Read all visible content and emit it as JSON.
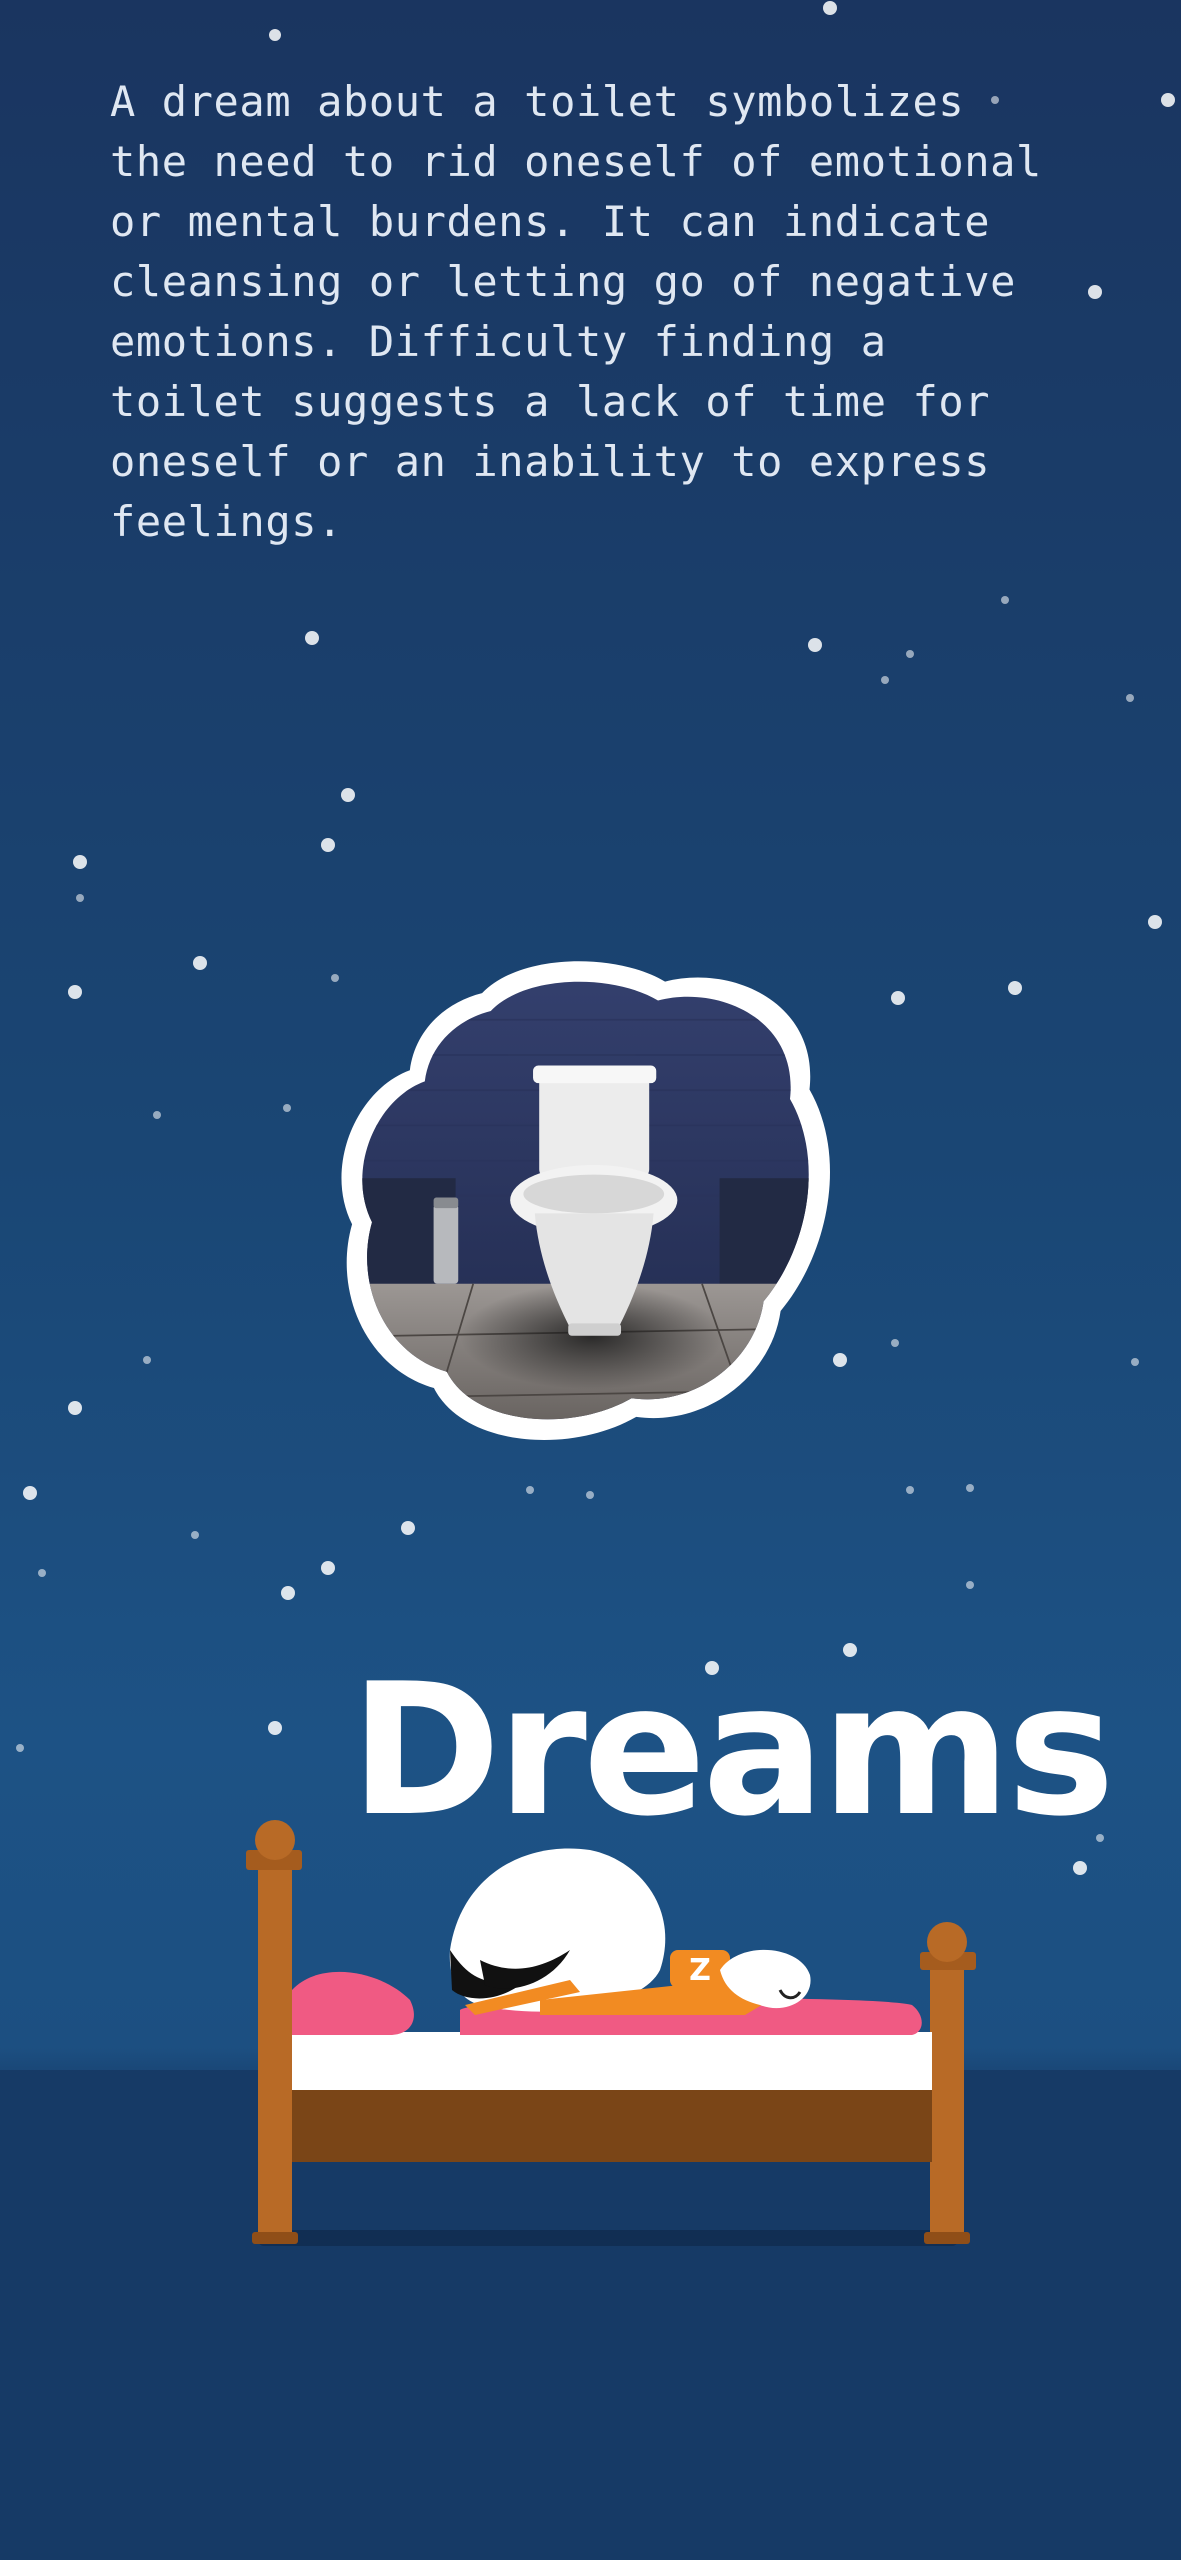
{
  "dream_text": "A dream about a toilet symbolizes\nthe need to rid oneself of emotional\nor mental burdens. It can indicate\ncleansing or letting go of negative\nemotions. Difficulty finding a\ntoilet suggests a lack of time for\noneself or an inability to express\nfeelings.",
  "brand": {
    "title": "Dreams",
    "bed_emblem_letter": "Z"
  },
  "colors": {
    "background_top": "#1a3560",
    "background_mid": "#1d5285",
    "floor": "#163a66",
    "text": "#dfe7f2",
    "bed_wood": "#b86a26",
    "bed_frame_dark": "#7a4517",
    "pillow_pink": "#f05a83",
    "sheet_white": "#ffffff",
    "stork_orange": "#f28b22"
  },
  "images": {
    "toilet_scene_icon": "toilet-in-bathroom",
    "bed_illustration_icon": "sleeping-stork-on-bed"
  }
}
